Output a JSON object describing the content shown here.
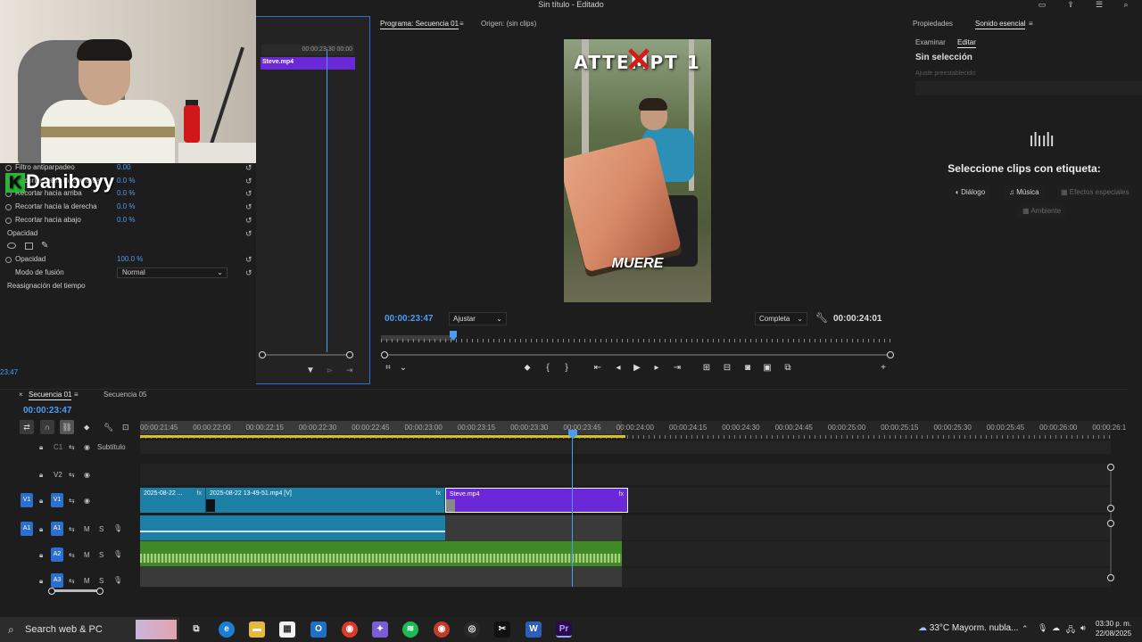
{
  "window": {
    "title": "Sin título - Editado"
  },
  "brand": {
    "letter": "K",
    "name": "Daniboyy"
  },
  "effects": {
    "rows": [
      {
        "label": "Filtro antiparpadeo",
        "value": "0.00"
      },
      {
        "label": "Recortar hacia la izquierda",
        "value": "0.0 %"
      },
      {
        "label": "Recortar hacia arriba",
        "value": "0.0 %"
      },
      {
        "label": "Recortar hacia la derecha",
        "value": "0.0 %"
      },
      {
        "label": "Recortar hacia abajo",
        "value": "0.0 %"
      }
    ],
    "opacity_section": "Opacidad",
    "opacity_label": "Opacidad",
    "opacity_value": "100.0 %",
    "blend_label": "Modo de fusión",
    "blend_value": "Normal",
    "time_remap": "Reasignación del tiempo",
    "current_time": "23:47"
  },
  "mini_timeline": {
    "ruler_time": "00:00:23:30",
    "ruler_time2": "00:00",
    "clip": "Steve.mp4"
  },
  "program": {
    "tab_program": "Programa: Secuencia 01",
    "tab_source": "Origen: (sin clips)",
    "video_title": "ATTEMPT 1",
    "video_caption": "MUERE",
    "current_time": "00:00:23:47",
    "fit": "Ajustar",
    "quality": "Completa",
    "duration": "00:00:24:01"
  },
  "essential_sound": {
    "tab_properties": "Propiedades",
    "tab_sound": "Sonido esencial",
    "sub_tab_browse": "Examinar",
    "sub_tab_edit": "Editar",
    "heading": "Sin selección",
    "preset_label": "Ajuste preestablecido:",
    "message": "Seleccione clips con etiqueta:",
    "buttons": [
      "Diálogo",
      "Música",
      "Efectos especiales",
      "Ambiente"
    ]
  },
  "timeline": {
    "tabs": [
      "Secuencia 01",
      "Secuencia 05"
    ],
    "current_time": "00:00:23:47",
    "ticks": [
      "00:00:21:45",
      "00:00:22:00",
      "00:00:22:15",
      "00:00:22:30",
      "00:00:22:45",
      "00:00:23:00",
      "00:00:23:15",
      "00:00:23:30",
      "00:00:23:45",
      "00:00:24:00",
      "00:00:24:15",
      "00:00:24:30",
      "00:00:24:45",
      "00:00:25:00",
      "00:00:25:15",
      "00:00:25:30",
      "00:00:25:45",
      "00:00:26:00",
      "00:00:26:1"
    ],
    "tracks": {
      "c1": "C1",
      "subtitle": "Subtítulo",
      "v2": "V2",
      "v1": "V1",
      "a1": "A1",
      "a2": "A2",
      "a3": "A3",
      "mute": "M",
      "solo": "S"
    },
    "clips": {
      "v1a": "2025-08-22 ...",
      "v1b": "2025-08-22 13-49-51.mp4 [V]",
      "v1c": "Steve.mp4"
    }
  },
  "taskbar": {
    "search_placeholder": "Search web & PC",
    "temperature": "33°C",
    "weather": "Mayorm. nubla...",
    "time": "03:30 p. m.",
    "date": "22/08/2025"
  }
}
